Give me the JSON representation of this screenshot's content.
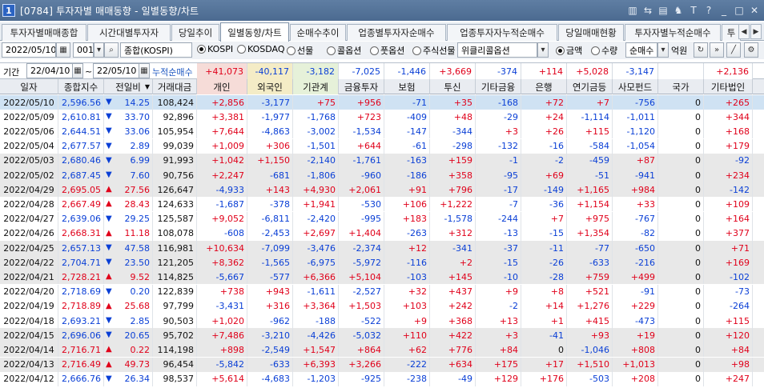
{
  "window": {
    "number": "1",
    "title": "[0784] 투자자별 매매동향 - 일별동향/차트",
    "icons": [
      "screen-icon",
      "link-icon",
      "chart-icon",
      "pin-icon",
      "font-icon",
      "help-icon",
      "minimize-icon",
      "maximize-icon",
      "close-icon"
    ],
    "icon_glyphs": [
      "▥",
      "⇆",
      "▤",
      "♞",
      "T",
      "?",
      "_",
      "□",
      "✕"
    ]
  },
  "tabs": [
    "투자자별매매종합",
    "시간대별투자자",
    "당일추이",
    "일별동향/차트",
    "순매수추이",
    "업종별투자자순매수",
    "업종투자자누적순매수",
    "당일매매현황",
    "투자자별누적순매수",
    "투"
  ],
  "active_tab": 3,
  "toolbar": {
    "date": "2022/05/10",
    "code": "001",
    "market_name": "종합(KOSPI)",
    "radios": [
      {
        "label": "KOSPI",
        "on": true
      },
      {
        "label": "KOSDAQ",
        "on": false
      },
      {
        "label": "선물",
        "on": false
      },
      {
        "label": "콜옵션",
        "on": false
      },
      {
        "label": "풋옵션",
        "on": false
      },
      {
        "label": "주식선물",
        "on": false
      }
    ],
    "weekly_option": "위클리콜옵션",
    "radios2": [
      {
        "label": "금액",
        "on": true
      },
      {
        "label": "수량",
        "on": false
      }
    ],
    "mode": "순매수",
    "unit": "억원"
  },
  "summary": {
    "period_label": "기간",
    "from": "22/04/10",
    "tilde": "~",
    "to": "22/05/10",
    "label": "누적순매수",
    "values": [
      "+41,073",
      "-40,117",
      "-3,182",
      "-7,025",
      "-1,446",
      "+3,669",
      "-374",
      "+114",
      "+5,028",
      "-3,147",
      "",
      "+2,136"
    ]
  },
  "columns": [
    "일자",
    "종합지수",
    "전일비",
    "거래대금",
    "개인",
    "외국인",
    "기관계",
    "금융투자",
    "보험",
    "투신",
    "기타금융",
    "은행",
    "연기금등",
    "사모펀드",
    "국가",
    "기타법인"
  ],
  "rows": [
    {
      "date": "2022/05/10",
      "idx": "2,596.56",
      "dir": "down",
      "chg": "14.25",
      "amt": "108,424",
      "v": [
        "+2,856",
        "-3,177",
        "+75",
        "+956",
        "-71",
        "+35",
        "-168",
        "+72",
        "+7",
        "-756",
        "0",
        "+265"
      ]
    },
    {
      "date": "2022/05/09",
      "idx": "2,610.81",
      "dir": "down",
      "chg": "33.70",
      "amt": "92,896",
      "v": [
        "+3,381",
        "-1,977",
        "-1,768",
        "+723",
        "-409",
        "+48",
        "-29",
        "+24",
        "-1,114",
        "-1,011",
        "0",
        "+344"
      ]
    },
    {
      "date": "2022/05/06",
      "idx": "2,644.51",
      "dir": "down",
      "chg": "33.06",
      "amt": "105,954",
      "v": [
        "+7,644",
        "-4,863",
        "-3,002",
        "-1,534",
        "-147",
        "-344",
        "+3",
        "+26",
        "+115",
        "-1,120",
        "0",
        "+168"
      ]
    },
    {
      "date": "2022/05/04",
      "idx": "2,677.57",
      "dir": "down",
      "chg": "2.89",
      "amt": "99,039",
      "v": [
        "+1,009",
        "+306",
        "-1,501",
        "+644",
        "-61",
        "-298",
        "-132",
        "-16",
        "-584",
        "-1,054",
        "0",
        "+179"
      ]
    },
    {
      "date": "2022/05/03",
      "idx": "2,680.46",
      "dir": "down",
      "chg": "6.99",
      "amt": "91,993",
      "v": [
        "+1,042",
        "+1,150",
        "-2,140",
        "-1,761",
        "-163",
        "+159",
        "-1",
        "-2",
        "-459",
        "+87",
        "0",
        "-92"
      ]
    },
    {
      "date": "2022/05/02",
      "idx": "2,687.45",
      "dir": "down",
      "chg": "7.60",
      "amt": "90,756",
      "v": [
        "+2,247",
        "-681",
        "-1,806",
        "-960",
        "-186",
        "+358",
        "-95",
        "+69",
        "-51",
        "-941",
        "0",
        "+234"
      ]
    },
    {
      "date": "2022/04/29",
      "idx": "2,695.05",
      "dir": "up",
      "chg": "27.56",
      "amt": "126,647",
      "v": [
        "-4,933",
        "+143",
        "+4,930",
        "+2,061",
        "+91",
        "+796",
        "-17",
        "-149",
        "+1,165",
        "+984",
        "0",
        "-142"
      ]
    },
    {
      "date": "2022/04/28",
      "idx": "2,667.49",
      "dir": "up",
      "chg": "28.43",
      "amt": "124,633",
      "v": [
        "-1,687",
        "-378",
        "+1,941",
        "-530",
        "+106",
        "+1,222",
        "-7",
        "-36",
        "+1,154",
        "+33",
        "0",
        "+109"
      ]
    },
    {
      "date": "2022/04/27",
      "idx": "2,639.06",
      "dir": "down",
      "chg": "29.25",
      "amt": "125,587",
      "v": [
        "+9,052",
        "-6,811",
        "-2,420",
        "-995",
        "+183",
        "-1,578",
        "-244",
        "+7",
        "+975",
        "-767",
        "0",
        "+164"
      ]
    },
    {
      "date": "2022/04/26",
      "idx": "2,668.31",
      "dir": "up",
      "chg": "11.18",
      "amt": "108,078",
      "v": [
        "-608",
        "-2,453",
        "+2,697",
        "+1,404",
        "-263",
        "+312",
        "-13",
        "-15",
        "+1,354",
        "-82",
        "0",
        "+377"
      ]
    },
    {
      "date": "2022/04/25",
      "idx": "2,657.13",
      "dir": "down",
      "chg": "47.58",
      "amt": "116,981",
      "v": [
        "+10,634",
        "-7,099",
        "-3,476",
        "-2,374",
        "+12",
        "-341",
        "-37",
        "-11",
        "-77",
        "-650",
        "0",
        "+71"
      ]
    },
    {
      "date": "2022/04/22",
      "idx": "2,704.71",
      "dir": "down",
      "chg": "23.50",
      "amt": "121,205",
      "v": [
        "+8,362",
        "-1,565",
        "-6,975",
        "-5,972",
        "-116",
        "+2",
        "-15",
        "-26",
        "-633",
        "-216",
        "0",
        "+169"
      ]
    },
    {
      "date": "2022/04/21",
      "idx": "2,728.21",
      "dir": "up",
      "chg": "9.52",
      "amt": "114,825",
      "v": [
        "-5,667",
        "-577",
        "+6,366",
        "+5,104",
        "-103",
        "+145",
        "-10",
        "-28",
        "+759",
        "+499",
        "0",
        "-102"
      ]
    },
    {
      "date": "2022/04/20",
      "idx": "2,718.69",
      "dir": "down",
      "chg": "0.20",
      "amt": "122,839",
      "v": [
        "+738",
        "+943",
        "-1,611",
        "-2,527",
        "+32",
        "+437",
        "+9",
        "+8",
        "+521",
        "-91",
        "0",
        "-73"
      ]
    },
    {
      "date": "2022/04/19",
      "idx": "2,718.89",
      "dir": "up",
      "chg": "25.68",
      "amt": "97,799",
      "v": [
        "-3,431",
        "+316",
        "+3,364",
        "+1,503",
        "+103",
        "+242",
        "-2",
        "+14",
        "+1,276",
        "+229",
        "0",
        "-264"
      ]
    },
    {
      "date": "2022/04/18",
      "idx": "2,693.21",
      "dir": "down",
      "chg": "2.85",
      "amt": "90,503",
      "v": [
        "+1,020",
        "-962",
        "-188",
        "-522",
        "+9",
        "+368",
        "+13",
        "+1",
        "+415",
        "-473",
        "0",
        "+115"
      ]
    },
    {
      "date": "2022/04/15",
      "idx": "2,696.06",
      "dir": "down",
      "chg": "20.65",
      "amt": "95,702",
      "v": [
        "+7,486",
        "-3,210",
        "-4,426",
        "-5,032",
        "+110",
        "+422",
        "+3",
        "-41",
        "+93",
        "+19",
        "0",
        "+120"
      ]
    },
    {
      "date": "2022/04/14",
      "idx": "2,716.71",
      "dir": "up",
      "chg": "0.22",
      "amt": "114,198",
      "v": [
        "+898",
        "-2,549",
        "+1,547",
        "+864",
        "+62",
        "+776",
        "+84",
        "0",
        "-1,046",
        "+808",
        "0",
        "+84"
      ]
    },
    {
      "date": "2022/04/13",
      "idx": "2,716.49",
      "dir": "up",
      "chg": "49.73",
      "amt": "96,454",
      "v": [
        "-5,842",
        "-633",
        "+6,393",
        "+3,266",
        "-222",
        "+634",
        "+175",
        "+17",
        "+1,510",
        "+1,013",
        "0",
        "+98"
      ]
    },
    {
      "date": "2022/04/12",
      "idx": "2,666.76",
      "dir": "down",
      "chg": "26.34",
      "amt": "98,537",
      "v": [
        "+5,614",
        "-4,683",
        "-1,203",
        "-925",
        "-238",
        "-49",
        "+129",
        "+176",
        "-503",
        "+208",
        "0",
        "+247"
      ]
    }
  ],
  "colors": {
    "up": "#e0001a",
    "down": "#0a3fd6",
    "sel_row": "#cfe2f3",
    "alt_row": "#e8e8e8"
  }
}
